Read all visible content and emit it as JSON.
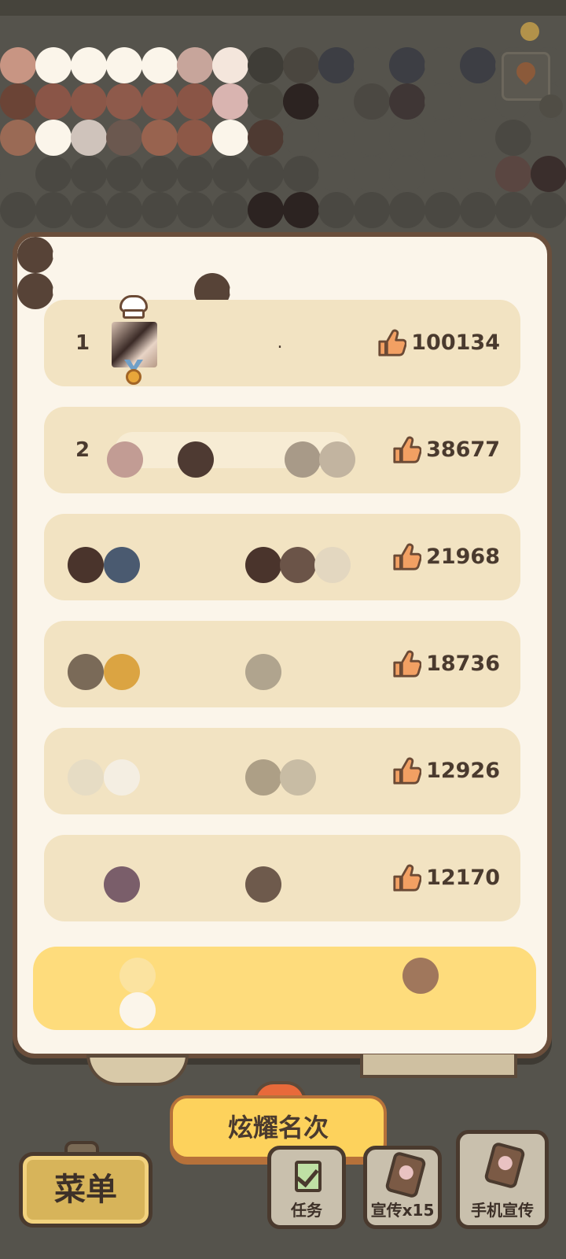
{
  "leaderboard": {
    "rows": [
      {
        "rank": "1",
        "name": ".",
        "likes": "100134"
      },
      {
        "rank": "2",
        "name": "",
        "likes": "38677"
      },
      {
        "rank": "",
        "name": "",
        "likes": "21968"
      },
      {
        "rank": "",
        "name": "",
        "likes": "18736"
      },
      {
        "rank": "",
        "name": "",
        "likes": "12926"
      },
      {
        "rank": "",
        "name": "",
        "likes": "12170"
      }
    ]
  },
  "actions": {
    "show_rank_label": "炫耀名次",
    "menu_label": "菜单",
    "task_label": "任务",
    "promote_label": "宣传x15",
    "phone_promote_label": "手机宣传"
  },
  "colors": {
    "panel_bg": "#fbf5ea",
    "row_bg": "#f2e3c2",
    "my_row_bg": "#fedc7c",
    "button_yellow": "#fdd25c",
    "border_brown": "#6a4e3b"
  },
  "icons": {
    "like": "thumbs-up-icon",
    "map": "map-icon",
    "task": "checklist-icon",
    "promote": "phone-icon"
  }
}
